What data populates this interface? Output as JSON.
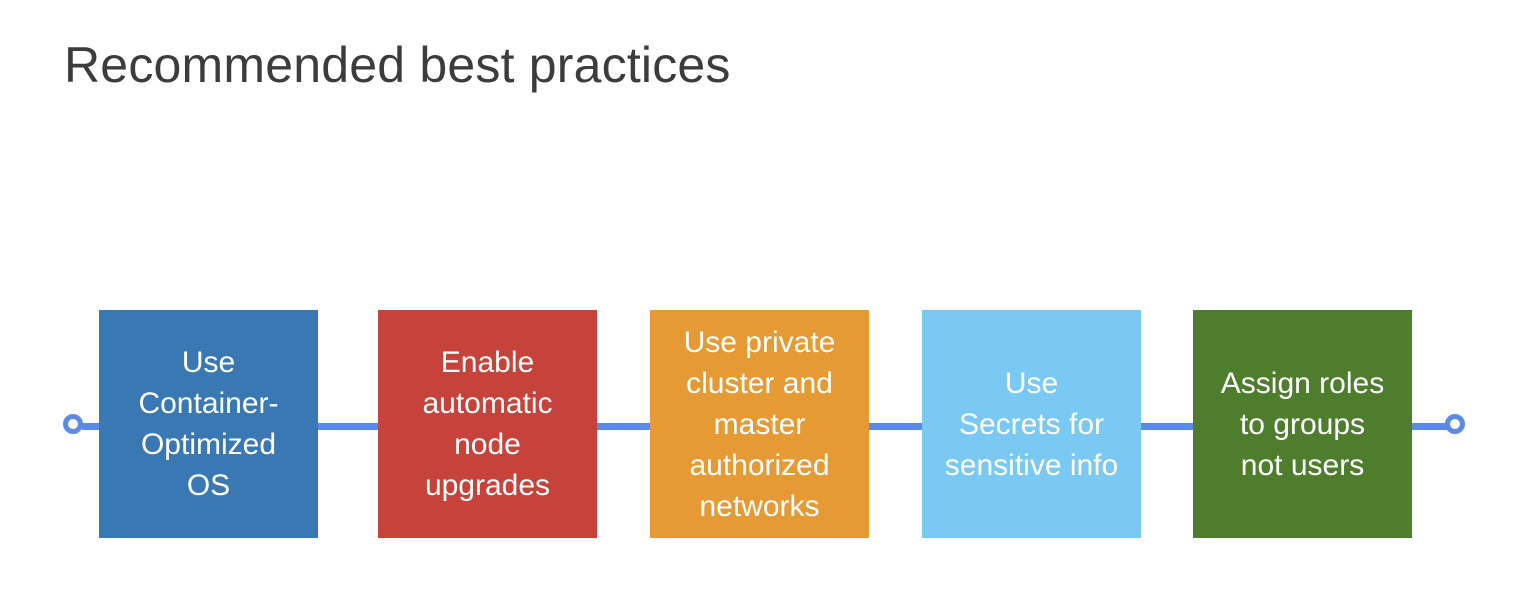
{
  "slide": {
    "title": "Recommended best practices"
  },
  "colors": {
    "connector": "#5b8ae6",
    "endpoint": "#5b8ae6"
  },
  "steps": [
    {
      "label": "Use Container-Optimized OS",
      "lines": [
        "Use",
        "Container-",
        "Optimized",
        "OS"
      ],
      "color": "#3a78b4"
    },
    {
      "label": "Enable automatic node upgrades",
      "lines": [
        "Enable",
        "automatic",
        "node",
        "upgrades"
      ],
      "color": "#c5433a"
    },
    {
      "label": "Use private cluster and master authorized networks",
      "lines": [
        "Use private",
        "cluster and",
        "master",
        "authorized",
        "networks"
      ],
      "color": "#e69a33"
    },
    {
      "label": "Use Secrets for sensitive info",
      "lines": [
        "Use",
        "Secrets for",
        "sensitive info"
      ],
      "color": "#79c9f2"
    },
    {
      "label": "Assign roles to groups not users",
      "lines": [
        "Assign roles",
        "to groups",
        "not users"
      ],
      "color": "#4f7d2e"
    }
  ]
}
